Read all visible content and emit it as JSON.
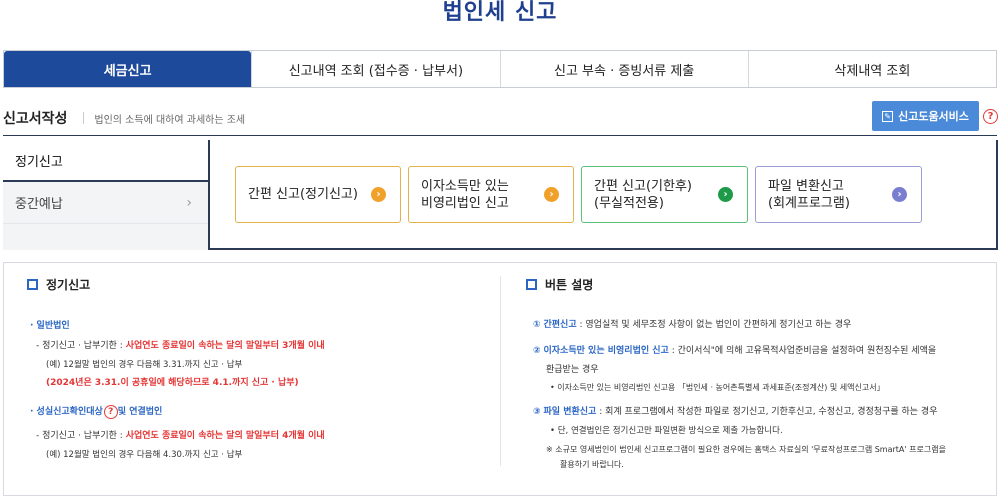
{
  "page_title": "법인세 신고",
  "tabs": [
    {
      "label": "세금신고"
    },
    {
      "label": "신고내역 조회 (접수증 · 납부서)"
    },
    {
      "label": "신고 부속 · 증빙서류 제출"
    },
    {
      "label": "삭제내역 조회"
    }
  ],
  "section": {
    "title": "신고서작성",
    "desc": "법인의 소득에 대하여 과세하는 조세"
  },
  "help_button": {
    "label": "신고도움서비스",
    "q": "?"
  },
  "left_menu": [
    {
      "label": "정기신고"
    },
    {
      "label": "중간예납",
      "chevron": "›"
    }
  ],
  "cards": [
    {
      "line1": "간편 신고(정기신고)",
      "line2": "",
      "arrow": "›"
    },
    {
      "line1": "이자소득만 있는",
      "line2": "비영리법인 신고",
      "arrow": "›"
    },
    {
      "line1": "간편 신고(기한후)",
      "line2": "(무실적전용)",
      "arrow": "›"
    },
    {
      "line1": "파일 변환신고",
      "line2": "(회계프로그램)",
      "arrow": "›"
    }
  ],
  "left_block": {
    "title": "정기신고",
    "general": {
      "label": "· 일반법인",
      "deadline_prefix": "- 정기신고 · 납부기한 : ",
      "deadline_red": "사업연도 종료일이 속하는 달의 말일부터 3개월 이내",
      "example": "(예) 12월말 법인의 경우 다음해 3.31.까지 신고 · 납부",
      "note_red": "(2024년은 3.31.이 공휴일에 해당하므로 4.1.까지 신고 · 납부)"
    },
    "confirm": {
      "label_a": "· 성실신고확인대상",
      "q": "?",
      "label_b": "및 연결법인",
      "deadline_prefix": "- 정기신고 · 납부기한 : ",
      "deadline_red": "사업연도 종료일이 속하는 달의 말일부터 4개월 이내",
      "example": "(예) 12월말 법인의 경우 다음해 4.30.까지 신고 · 납부"
    }
  },
  "right_block": {
    "title": "버튼 설명",
    "items": [
      {
        "num": "①",
        "key": "간편신고",
        "text": " : 영업실적 및 세무조정 사항이 없는 법인이 간편하게 정기신고 하는 경우"
      },
      {
        "num": "②",
        "key": "이자소득만 있는 비영리법인 신고",
        "text": " : 간이서식\"에 의해 고유목적사업준비금을 설정하여 원천징수된 세액을",
        "cont": "환급받는 경우",
        "bullet": "• 이자소득만 있는 비영리법인 신고용 「법인세 · 농어촌특별세 과세표준(조정계산) 및 세액신고서」"
      },
      {
        "num": "③",
        "key": "파일 변환신고",
        "text": " : 회계 프로그램에서 작성한 파일로 정기신고, 기한후신고, 수정신고, 경정청구를 하는 경우",
        "bullet": "• 단, 연결법인은 정기신고만 파일변환 방식으로 제출 가능합니다."
      }
    ],
    "note1": "※ 소규모 영세법인이 법인세 신고프로그램이 필요한 경우에는 홈택스 자료실의 '무료작성프로그램 SmartA' 프로그램을",
    "note2": "활용하기 바랍니다."
  }
}
